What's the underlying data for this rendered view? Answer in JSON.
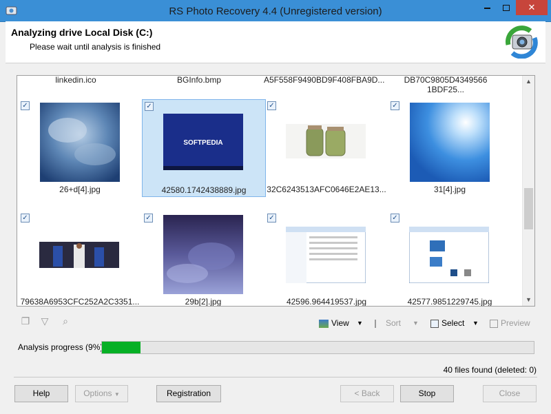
{
  "window": {
    "title": "RS Photo Recovery 4.4 (Unregistered version)"
  },
  "header": {
    "title": "Analyzing drive Local Disk (C:)",
    "subtitle": "Please wait until analysis is finished"
  },
  "gallery": {
    "top_row_names": [
      "linkedin.ico",
      "BGInfo.bmp",
      "A5F558F9490BD9F408FBA9D...",
      "DB70C9805D4349566 1BDF25..."
    ],
    "row1": [
      {
        "name": "26+d[4].jpg",
        "checked": true
      },
      {
        "name": "42580.1742438889.jpg",
        "checked": true,
        "selected": true,
        "thumb_text": "SOFTPEDIA"
      },
      {
        "name": "32C6243513AFC0646E2AE13...",
        "checked": true
      },
      {
        "name": "31[4].jpg",
        "checked": true
      }
    ],
    "row2": [
      {
        "name": "79638A6953CFC252A2C3351...",
        "checked": true
      },
      {
        "name": "29b[2].jpg",
        "checked": true
      },
      {
        "name": "42596.964419537.jpg",
        "checked": true
      },
      {
        "name": "42577.9851229745.jpg",
        "checked": true
      }
    ]
  },
  "toolbar": {
    "view_label": "View",
    "sort_label": "Sort",
    "select_label": "Select",
    "preview_label": "Preview"
  },
  "progress": {
    "label": "Analysis progress (9%)",
    "percent": 9
  },
  "status": {
    "found": "40 files found (deleted: 0)"
  },
  "buttons": {
    "help": "Help",
    "options": "Options",
    "registration": "Registration",
    "back": "< Back",
    "stop": "Stop",
    "close": "Close"
  }
}
